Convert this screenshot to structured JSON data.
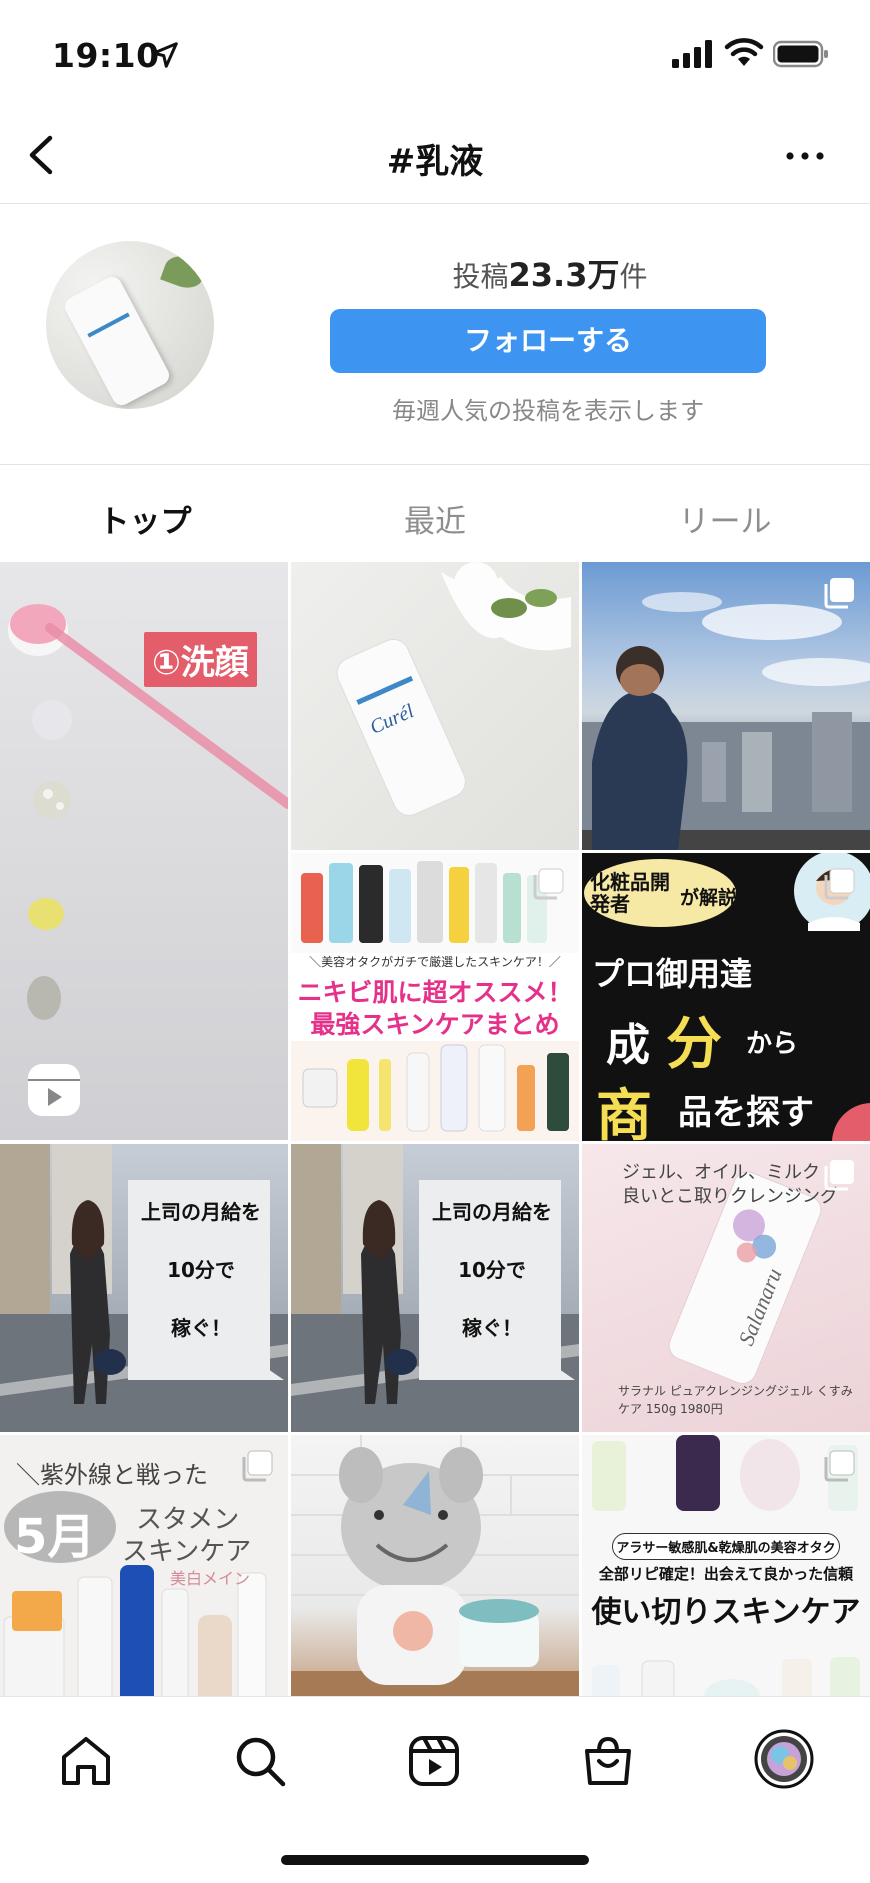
{
  "status_bar": {
    "time": "19:10"
  },
  "header": {
    "title": "#乳液"
  },
  "profile": {
    "posts_prefix": "投稿",
    "posts_count": "23.3万",
    "posts_suffix": "件",
    "follow_label": "フォローする",
    "weekly_text": "毎週人気の投稿を表示します"
  },
  "tabs": [
    {
      "label": "トップ",
      "active": true
    },
    {
      "label": "最近",
      "active": false
    },
    {
      "label": "リール",
      "active": false
    }
  ],
  "grid": {
    "tile1_caption": "①洗顔",
    "tile4_line1": "＼美容オタクがガチで厳選したスキンケア！／",
    "tile4_line2": "ニキビ肌に超オススメ！",
    "tile4_line3": "最強スキンケアまとめ",
    "tile5_badge": "化粧品開発者",
    "tile5_badge_suffix": "が解説",
    "tile5_line1": "プロ御用達",
    "tile5_line2a": "成",
    "tile5_line2b": "分",
    "tile5_line2c": "から",
    "tile5_line3a": "商",
    "tile5_line3b": "品を探す",
    "tile6_line1": "上司の月給を",
    "tile6_line2": "10分で",
    "tile6_line3": "稼ぐ！",
    "tile8_line1": "ジェル、オイル、ミルク",
    "tile8_line2": "良いとこ取りクレンジング",
    "tile8_brand": "Salanaru",
    "tile8_footer": "サラナル ピュアクレンジングジェル くすみケア 150g 1980円",
    "tile9_line1": "＼紫外線と戦った",
    "tile9_month": "5月",
    "tile9_line2": "スタメン",
    "tile9_line3": "スキンケア",
    "tile9_line4": "美白メイン",
    "tile11_line1": "アラサー敏感肌&乾燥肌の美容オタク",
    "tile11_line2": "全部リピ確定！出会えて良かった信頼",
    "tile11_line3": "使い切りスキンケア"
  },
  "nav": {
    "items": [
      "home-icon",
      "search-icon",
      "reels-icon",
      "shop-icon",
      "profile-avatar"
    ]
  },
  "colors": {
    "accent": "#3d95f1",
    "tile_red": "#e35d6a",
    "pink_text": "#e6318a"
  }
}
